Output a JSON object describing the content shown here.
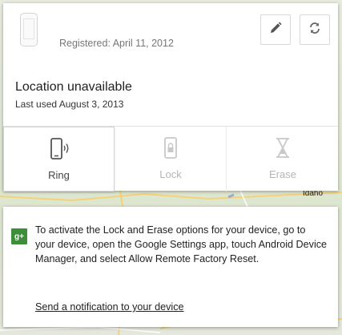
{
  "map": {
    "place_label": "Idaho"
  },
  "device": {
    "registered": "Registered: April 11, 2012",
    "location_status": "Location unavailable",
    "last_used": "Last used August 3, 2013",
    "edit_icon": "pencil-icon",
    "refresh_icon": "refresh-icon"
  },
  "actions": [
    {
      "label": "Ring",
      "icon": "phone-ring-icon",
      "enabled": true
    },
    {
      "label": "Lock",
      "icon": "phone-lock-icon",
      "enabled": false
    },
    {
      "label": "Erase",
      "icon": "erase-icon",
      "enabled": false
    }
  ],
  "info": {
    "text": "To activate the Lock and Erase options for your device, go to your device, open the Google Settings app, touch Android Device Manager, and select Allow Remote Factory Reset.",
    "link": "Send a notification to your device",
    "badge": "g+"
  }
}
